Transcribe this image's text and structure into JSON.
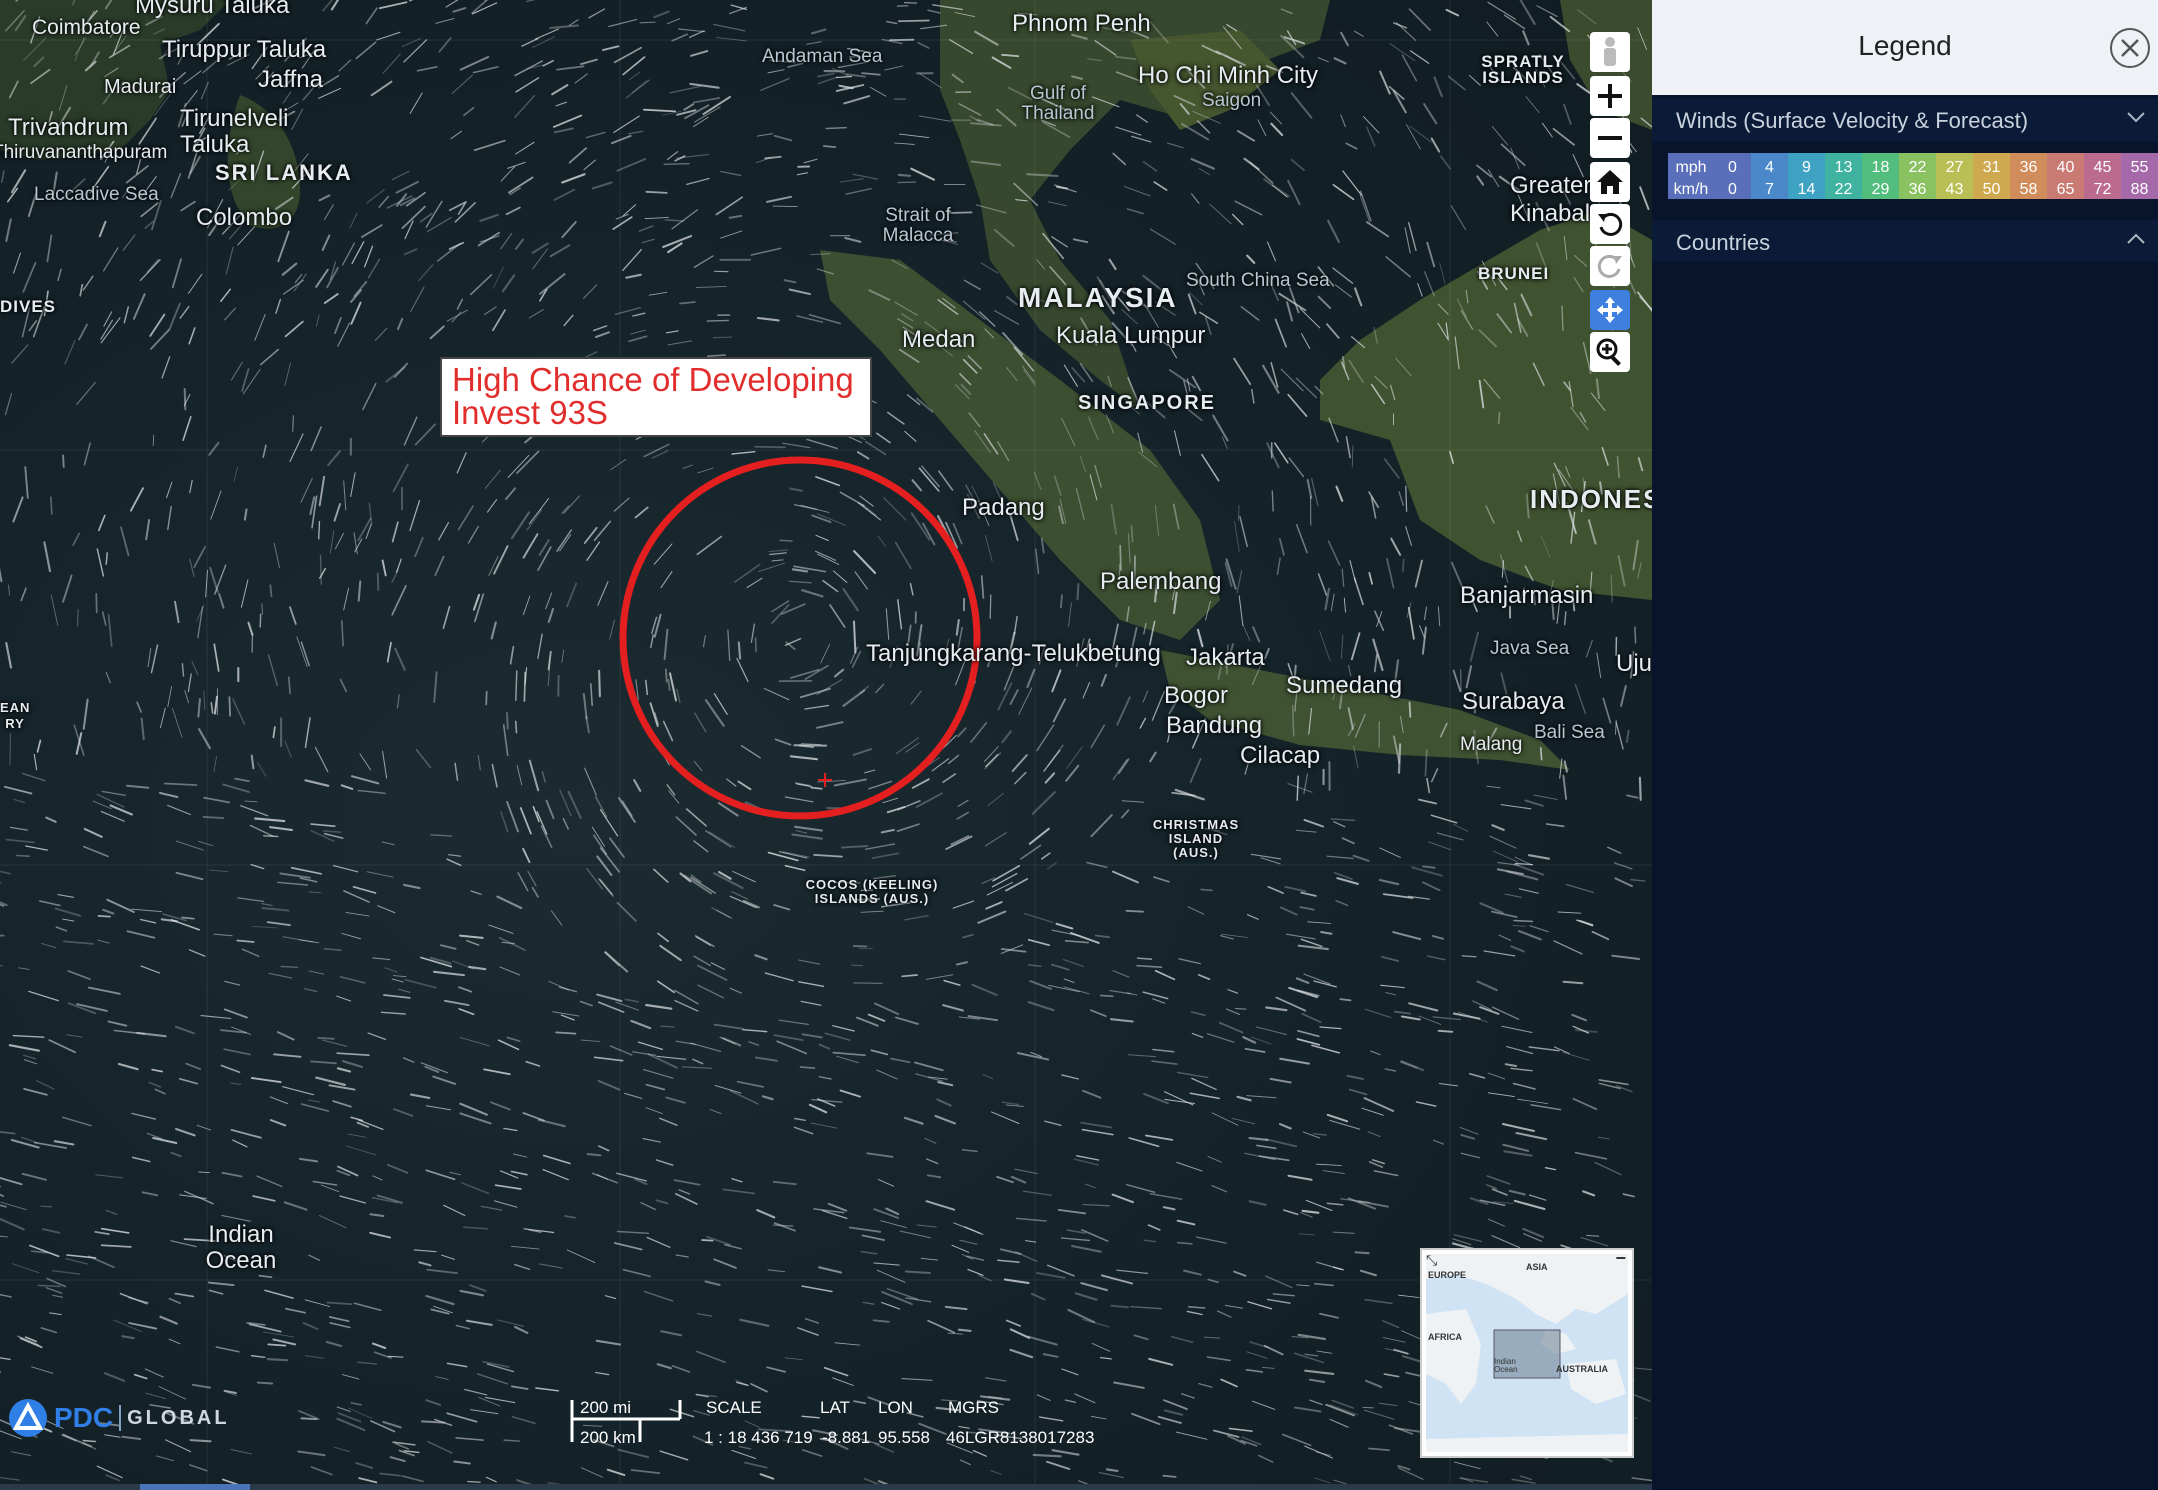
{
  "map": {
    "places": [
      {
        "name": "Mysuru Taluka",
        "cls": ""
      },
      {
        "name": "Coimbatore",
        "cls": ""
      },
      {
        "name": "Tiruppur Taluka",
        "cls": ""
      },
      {
        "name": "Jaffna",
        "cls": ""
      },
      {
        "name": "Madurai",
        "cls": ""
      },
      {
        "name": "Tirunelveli Taluka",
        "cls": ""
      },
      {
        "name": "Trivandrum",
        "cls": ""
      },
      {
        "name": "Thiruvananthapuram",
        "cls": ""
      },
      {
        "name": "SRI LANKA",
        "cls": "caps"
      },
      {
        "name": "Laccadive Sea",
        "cls": "sea"
      },
      {
        "name": "Colombo",
        "cls": ""
      },
      {
        "name": "DIVES",
        "cls": "small"
      },
      {
        "name": "Andaman Sea",
        "cls": "sea"
      },
      {
        "name": "Phnom Penh",
        "cls": ""
      },
      {
        "name": "Gulf of Thailand",
        "cls": "sea"
      },
      {
        "name": "Ho Chi Minh City",
        "cls": ""
      },
      {
        "name": "Saigon",
        "cls": "sea"
      },
      {
        "name": "SPRATLY ISLANDS",
        "cls": "small"
      },
      {
        "name": "Strait of Malacca",
        "cls": "sea"
      },
      {
        "name": "MALAYSIA",
        "cls": "big"
      },
      {
        "name": "South China Sea",
        "cls": "sea"
      },
      {
        "name": "Kuala Lumpur",
        "cls": ""
      },
      {
        "name": "Medan",
        "cls": ""
      },
      {
        "name": "SINGAPORE",
        "cls": "caps"
      },
      {
        "name": "BRUNEI",
        "cls": "small"
      },
      {
        "name": "Greater Kinabalu",
        "cls": ""
      },
      {
        "name": "INDONESIA",
        "cls": "xl"
      },
      {
        "name": "Padang",
        "cls": ""
      },
      {
        "name": "Palembang",
        "cls": ""
      },
      {
        "name": "Banjarmasin",
        "cls": ""
      },
      {
        "name": "Tanjungkarang-Telukbetung",
        "cls": ""
      },
      {
        "name": "Jakarta",
        "cls": ""
      },
      {
        "name": "Java Sea",
        "cls": "sea"
      },
      {
        "name": "Bogor",
        "cls": ""
      },
      {
        "name": "Sumedang",
        "cls": ""
      },
      {
        "name": "Surabaya",
        "cls": ""
      },
      {
        "name": "Bandung",
        "cls": ""
      },
      {
        "name": "Cilacap",
        "cls": ""
      },
      {
        "name": "Malang",
        "cls": ""
      },
      {
        "name": "Bali Sea",
        "cls": "sea"
      },
      {
        "name": "Uju",
        "cls": ""
      },
      {
        "name": "CHRISTMAS ISLAND (AUS.)",
        "cls": "small"
      },
      {
        "name": "COCOS (KEELING) ISLANDS (AUS.)",
        "cls": "small"
      },
      {
        "name": "Indian Ocean",
        "cls": ""
      },
      {
        "name": "EAN RY",
        "cls": "small"
      }
    ]
  },
  "annotation": {
    "line1": "High Chance of Developing",
    "line2": "Invest 93S"
  },
  "toolbar": [
    {
      "name": "street-view-button",
      "icon": "person-icon"
    },
    {
      "name": "zoom-in-button",
      "icon": "plus-icon"
    },
    {
      "name": "zoom-out-button",
      "icon": "minus-icon"
    },
    {
      "name": "home-button",
      "icon": "home-icon"
    },
    {
      "name": "undo-view-button",
      "icon": "undo-icon"
    },
    {
      "name": "redo-view-button",
      "icon": "redo-icon"
    },
    {
      "name": "pan-tool-button",
      "icon": "move-icon"
    },
    {
      "name": "zoom-box-button",
      "icon": "magnify-plus-icon"
    }
  ],
  "overview": {
    "labels": {
      "europe": "EUROPE",
      "asia": "ASIA",
      "africa": "AFRICA",
      "indian": "Indian Ocean",
      "australia": "AUSTRALIA"
    }
  },
  "scale": {
    "mi": "200 mi",
    "km": "200 km",
    "scale_label": "SCALE",
    "scale_value": "1 : 18 436 719",
    "lat_label": "LAT",
    "lat_value": "-8.881",
    "lon_label": "LON",
    "lon_value": "95.558",
    "mgrs_label": "MGRS",
    "mgrs_value": "46LGR8138017283"
  },
  "logo": {
    "brand": "PDC",
    "product": "GLOBAL"
  },
  "legend": {
    "title": "Legend",
    "sections": {
      "winds": "Winds (Surface Velocity & Forecast)",
      "countries": "Countries"
    },
    "wind_scale": {
      "mph_label": "mph",
      "kmh_label": "km/h",
      "mph": [
        "0",
        "4",
        "9",
        "13",
        "18",
        "22",
        "27",
        "31",
        "36",
        "40",
        "45",
        "55"
      ],
      "kmh": [
        "0",
        "7",
        "14",
        "22",
        "29",
        "36",
        "43",
        "50",
        "58",
        "65",
        "72",
        "88"
      ],
      "colors": [
        "#5a6fb9",
        "#4a88c9",
        "#3ea2c2",
        "#3fb3a0",
        "#52bd7d",
        "#8ac262",
        "#b9bf55",
        "#cfa950",
        "#d08c5a",
        "#c97a73",
        "#bb6c8e",
        "#a569a9"
      ]
    }
  }
}
